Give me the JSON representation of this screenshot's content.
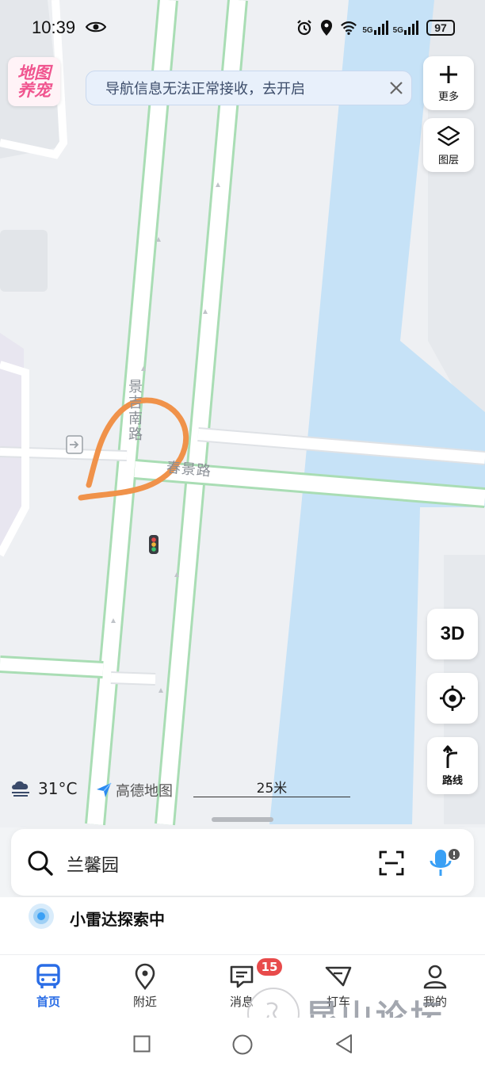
{
  "status": {
    "time": "10:39",
    "net1": "5G",
    "net2": "5G",
    "battery": "97"
  },
  "logo": {
    "line1": "地图",
    "line2": "养宠"
  },
  "notice": {
    "text": "导航信息无法正常接收，去开启"
  },
  "tools": {
    "more_label": "更多",
    "layers_label": "图层",
    "three_d_label": "3D",
    "route_label": "路线"
  },
  "map": {
    "road_vertical": "景吉南路",
    "road_horizontal": "春景路"
  },
  "weather": {
    "temperature": "31°C",
    "icon": "cloud-fog-icon"
  },
  "brand": {
    "name": "高德地图"
  },
  "scale": {
    "label": "25米"
  },
  "search": {
    "value": "兰馨园"
  },
  "radar": {
    "text": "小雷达探索中"
  },
  "nav": {
    "items": [
      {
        "label": "首页",
        "icon": "bus-icon",
        "active": true
      },
      {
        "label": "附近",
        "icon": "location-pin-icon",
        "active": false
      },
      {
        "label": "消息",
        "icon": "message-icon",
        "active": false
      },
      {
        "label": "打车",
        "icon": "taxi-icon",
        "active": false
      },
      {
        "label": "我的",
        "icon": "person-icon",
        "active": false
      }
    ],
    "message_badge": "15"
  },
  "watermark": {
    "text": "昆山论坛"
  },
  "colors": {
    "accent": "#2a6de6",
    "river": "#c6e2f7",
    "road_border": "#a9ddb4",
    "annotation": "#f0924a",
    "badge": "#e84b4b"
  }
}
